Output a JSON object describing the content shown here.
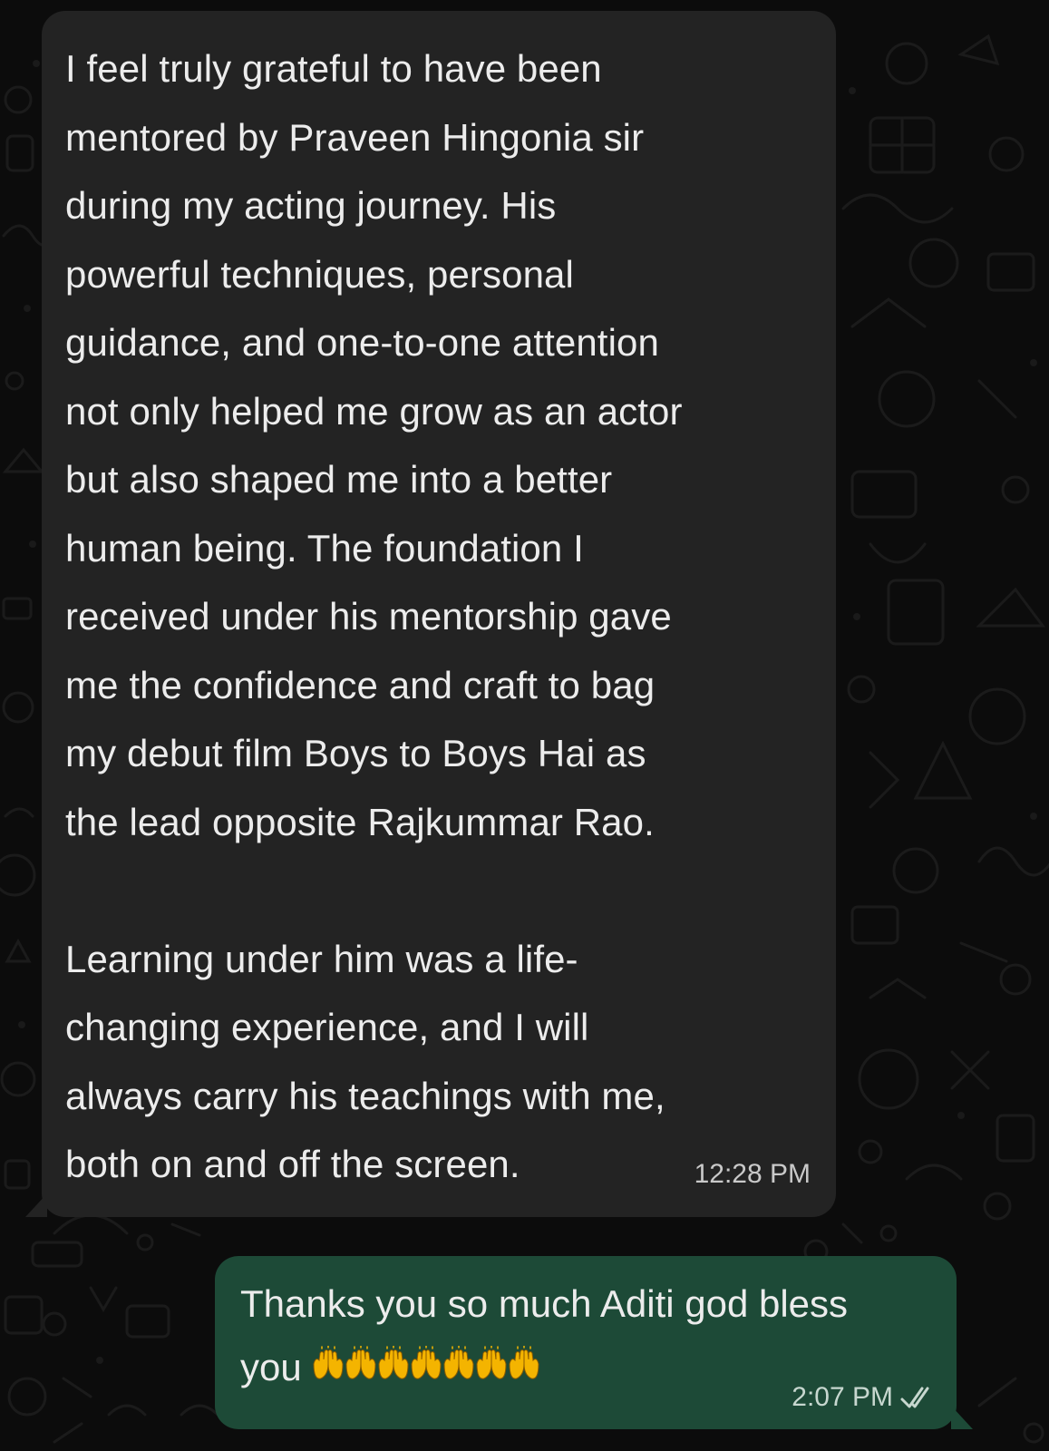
{
  "messages": {
    "incoming": {
      "text": "I feel truly grateful to have been\nmentored by Praveen Hingonia sir\nduring my acting journey. His\npowerful techniques, personal\nguidance, and one-to-one attention\nnot only helped me grow as an actor\nbut also shaped me into a better\nhuman being. The foundation I\nreceived under his mentorship gave\nme the confidence and craft to bag\nmy debut film Boys to Boys Hai as\nthe lead opposite Rajkummar Rao.\n\nLearning under him was a life-\nchanging experience, and I will\nalways carry his teachings with me,\nboth on and off the screen.",
      "time": "12:28 PM"
    },
    "outgoing": {
      "text": "Thanks you so much Aditi god bless\nyou",
      "emoji": "raising-hands",
      "emoji_count": 7,
      "time": "2:07 PM",
      "status_icon": "double-check-icon"
    }
  },
  "colors": {
    "background": "#0c0c0c",
    "incoming_bubble": "#232323",
    "outgoing_bubble": "#1d4a37",
    "text": "#ececec",
    "emoji": "#f4b400"
  }
}
